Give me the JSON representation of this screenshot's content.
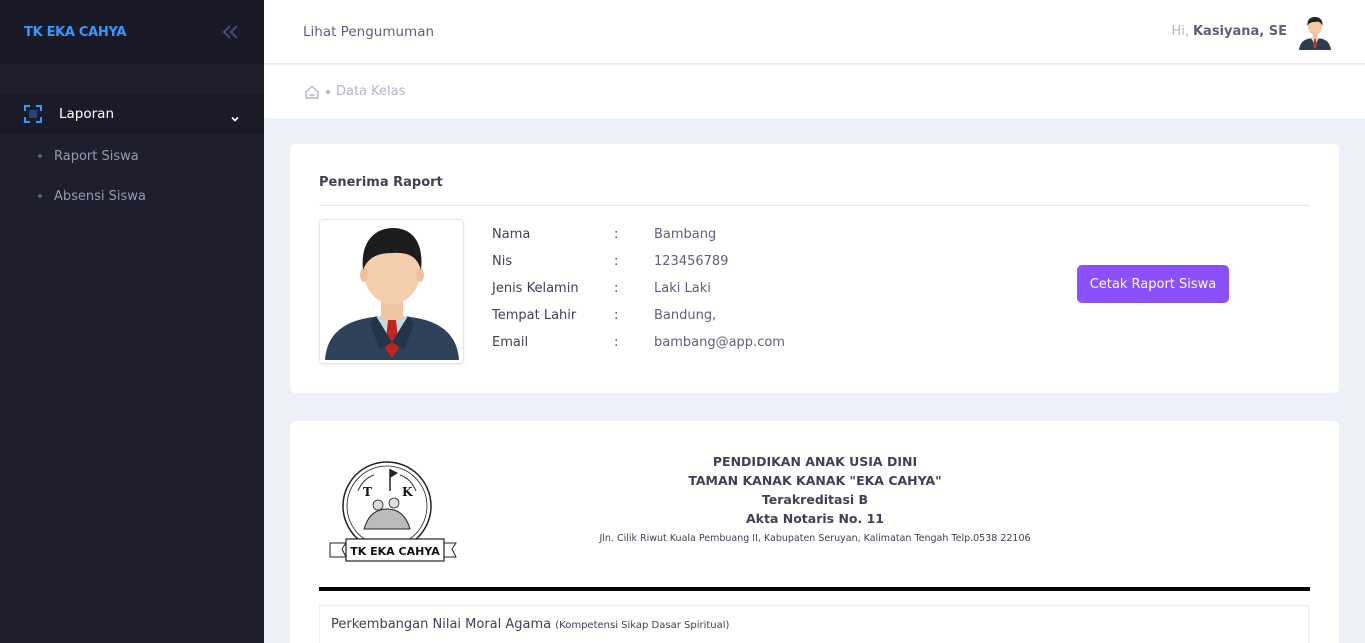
{
  "brand": {
    "name": "TK EKA CAHYA"
  },
  "sidebar": {
    "menu_label": "Laporan",
    "items": [
      {
        "label": "Raport Siswa"
      },
      {
        "label": "Absensi Siswa"
      }
    ]
  },
  "header": {
    "link": "Lihat Pengumuman",
    "greeting": "Hi,",
    "user_name": "Kasiyana, SE"
  },
  "breadcrumb": {
    "current": "Data Kelas"
  },
  "recipient": {
    "title": "Penerima Raport",
    "fields": [
      {
        "label": "Nama",
        "colon": ":",
        "value": "Bambang"
      },
      {
        "label": "Nis",
        "colon": ":",
        "value": "123456789"
      },
      {
        "label": "Jenis Kelamin",
        "colon": ":",
        "value": "Laki Laki"
      },
      {
        "label": "Tempat Lahir",
        "colon": ":",
        "value": "Bandung,"
      },
      {
        "label": "Email",
        "colon": ":",
        "value": "bambang@app.com"
      }
    ],
    "print_button": "Cetak Raport Siswa"
  },
  "report": {
    "logo_text": "TK EKA CAHYA",
    "line1": "PENDIDIKAN ANAK USIA DINI",
    "line2": "TAMAN KANAK KANAK \"EKA CAHYA\"",
    "line3": "Terakreditasi B",
    "line4": "Akta Notaris No. 11",
    "address": "Jln. Cilik Riwut Kuala Pembuang II, Kabupaten Seruyan, Kalimatan Tengah Telp.0538 22106",
    "section_title": "Perkembangan Nilai Moral Agama",
    "section_sub": "(Kompetensi Sikap Dasar Spiritual)"
  },
  "colors": {
    "sidebar_bg": "#1e1e2d",
    "brand_accent": "#3699ff",
    "primary_button": "#8950fc"
  },
  "icons": {
    "collapse": "double-chevron-left-icon",
    "menu": "scan-icon",
    "menu_arrow": "chevron-down-icon",
    "home": "home-icon"
  }
}
